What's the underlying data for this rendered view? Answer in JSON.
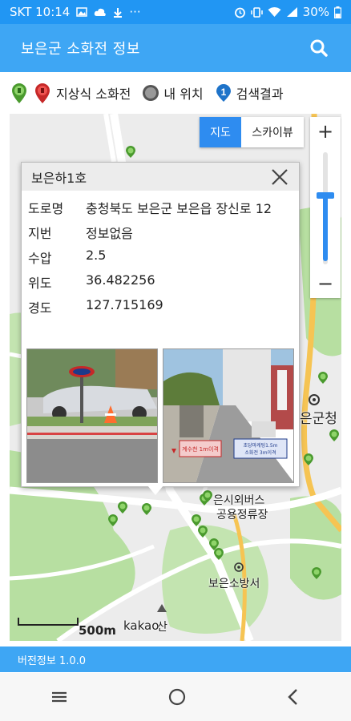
{
  "status_bar": {
    "carrier_time": "SKT 10:14",
    "battery": "30%",
    "more": "···"
  },
  "app_bar": {
    "title": "보은군 소화전 정보",
    "search_icon": "search-icon"
  },
  "legend": {
    "hydrant_label": "지상식 소화전",
    "my_location_label": "내 위치",
    "search_result_badge": "1",
    "search_result_label": "검색결과"
  },
  "map": {
    "map_type": {
      "map_label": "지도",
      "skyview_label": "스카이뷰",
      "active": "지도"
    },
    "zoom": {
      "plus": "+",
      "minus": "−"
    },
    "labels": {
      "county_office": "은군청",
      "bus_terminal_line1": "은시외버스",
      "bus_terminal_line2": "공용정류장",
      "fire_station": "보은소방서",
      "mountain": "산",
      "scale": "500m",
      "provider": "kakao"
    }
  },
  "popup": {
    "title": "보은하1호",
    "fields": [
      {
        "label": "도로명",
        "value": "충청북도 보은군 보은읍 장신로 12"
      },
      {
        "label": "지번",
        "value": "정보없음"
      },
      {
        "label": "수압",
        "value": "2.5"
      },
      {
        "label": "위도",
        "value": "36.482256"
      },
      {
        "label": "경도",
        "value": "127.715169"
      }
    ],
    "photo2_sign1": "계수천 1m이격",
    "photo2_sign2": "초당마케팅1.5m\n소화전 3m이격"
  },
  "footer": {
    "version": "버전정보 1.0.0"
  },
  "colors": {
    "primary": "#3ea6f4",
    "accent": "#2e8cf0",
    "hydrant_green": "#6cc24a",
    "hydrant_red": "#e03a3a"
  }
}
